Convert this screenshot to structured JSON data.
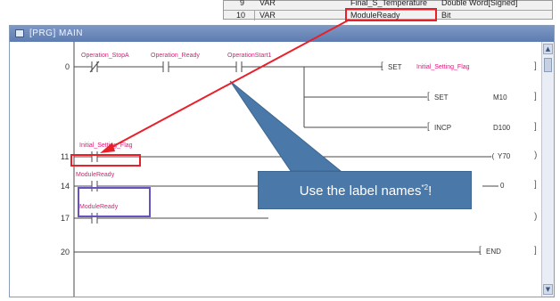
{
  "var_table": {
    "rows": [
      {
        "no": "9",
        "class": "VAR",
        "label": "Final_S_Temperature",
        "type": "Double Word[Signed]"
      },
      {
        "no": "10",
        "class": "VAR",
        "label": "ModuleReady",
        "type": "Bit"
      }
    ]
  },
  "window": {
    "title": "[PRG] MAIN"
  },
  "ladder": {
    "steps": [
      "0",
      "11",
      "14",
      "17",
      "20"
    ],
    "contacts": {
      "operation_stop": "Operation_StopA",
      "operation_ready": "Operation_Ready",
      "operation_start": "OperationStart1",
      "initial_setting_flag": "Initial_Setting_Flag",
      "module_ready_14": "ModuleReady",
      "module_ready_17": "ModuleReady"
    },
    "instructions": {
      "set_flag_op": "SET",
      "set_flag_arg": "Initial_Setting_Flag",
      "set_m10_op": "SET",
      "set_m10_arg": "M10",
      "incp_op": "INCP",
      "incp_arg": "D100",
      "coil_y70": "Y70",
      "row14_end": "0",
      "end_op": "END"
    }
  },
  "callout": {
    "text": "Use the label names",
    "footnote": "*2",
    "suffix": "!"
  },
  "colors": {
    "highlight": "#e8202a",
    "label_text": "#e0177a",
    "callout_bg": "#4a78a8",
    "selection": "#6b4fc4"
  }
}
